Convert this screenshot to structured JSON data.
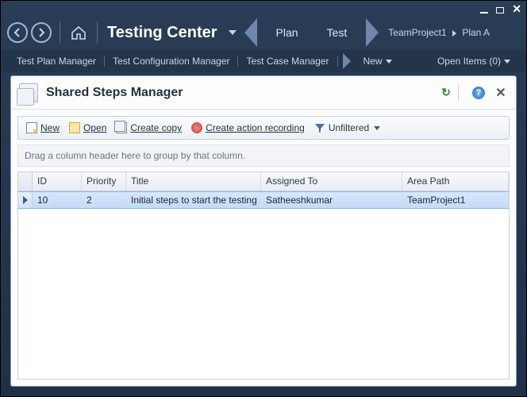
{
  "ribbon": {
    "app_title": "Testing Center",
    "tabs": {
      "plan": "Plan",
      "test": "Test"
    },
    "breadcrumb": {
      "project": "TeamProject1",
      "plan": "Plan A"
    }
  },
  "subnav": {
    "items": [
      "Test Plan Manager",
      "Test Configuration Manager",
      "Test Case Manager"
    ],
    "new_label": "New",
    "open_items_label": "Open Items (0)"
  },
  "panel": {
    "title": "Shared Steps Manager"
  },
  "toolbar": {
    "new": "New",
    "open": "Open",
    "create_copy": "Create copy",
    "create_action_recording": "Create action recording",
    "unfiltered": "Unfiltered"
  },
  "group_hint": "Drag a column header here to group by that column.",
  "grid": {
    "columns": {
      "id": "ID",
      "priority": "Priority",
      "title": "Title",
      "assigned_to": "Assigned To",
      "area_path": "Area Path"
    },
    "rows": [
      {
        "id": "10",
        "priority": "2",
        "title": "Initial steps to start the testing",
        "assigned_to": "Satheeshkumar",
        "area_path": "TeamProject1"
      }
    ]
  }
}
